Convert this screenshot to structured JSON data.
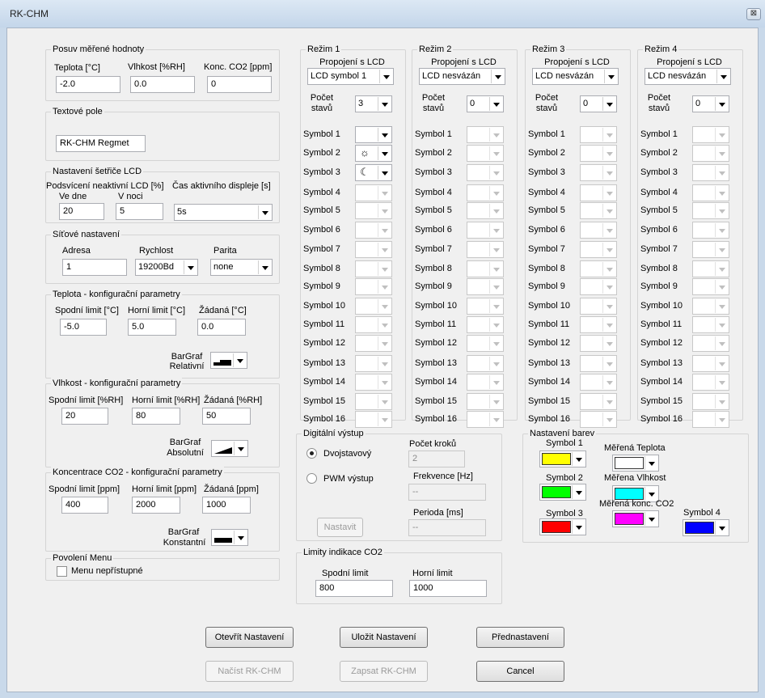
{
  "window": {
    "title": "RK-CHM",
    "close": "⊠"
  },
  "posuv": {
    "title": "Posuv měřené hodnoty",
    "labels": [
      "Teplota [°C]",
      "Vlhkost [%RH]",
      "Konc. CO2 [ppm]"
    ],
    "values": [
      "-2.0",
      "0.0",
      "0"
    ]
  },
  "textove": {
    "title": "Textové pole",
    "value": "RK-CHM Regmet"
  },
  "setric": {
    "title": "Nastavení šetřiče LCD",
    "label1": "Podsvícení neaktivní LCD [%]",
    "label2": "Čas aktivního displeje [s]",
    "ve_dne": "Ve dne",
    "v_noci": "V noci",
    "dne_value": "20",
    "noci_value": "5",
    "cas_value": "5s"
  },
  "sitove": {
    "title": "Síťové nastavení",
    "adresa_label": "Adresa",
    "rychlost_label": "Rychlost",
    "parita_label": "Parita",
    "adresa": "1",
    "rychlost": "19200Bd",
    "parita": "none"
  },
  "teplota": {
    "title": "Teplota - konfigurační parametry",
    "labels": [
      "Spodní limit [°C]",
      "Horní limit [°C]",
      "Žádaná [°C]"
    ],
    "values": [
      "-5.0",
      "5.0",
      "0.0"
    ],
    "bargraf": "BarGraf",
    "mode": "Relativní"
  },
  "vlhkost": {
    "title": "Vlhkost - konfigurační parametry",
    "labels": [
      "Spodní limit [%RH]",
      "Horní limit [%RH]",
      "Žádaná [%RH]"
    ],
    "values": [
      "20",
      "80",
      "50"
    ],
    "bargraf": "BarGraf",
    "mode": "Absolutní"
  },
  "co2": {
    "title": "Koncentrace CO2 - konfigurační parametry",
    "labels": [
      "Spodní limit [ppm]",
      "Horní limit [ppm]",
      "Žádaná [ppm]"
    ],
    "values": [
      "400",
      "2000",
      "1000"
    ],
    "bargraf": "BarGraf",
    "mode": "Konstantní"
  },
  "menu": {
    "title": "Povolení Menu",
    "checkbox_label": "Menu nepřístupné"
  },
  "rezimy": [
    {
      "title": "Režim 1",
      "lcd_label": "Propojení s LCD",
      "lcd_value": "LCD symbol 1",
      "pocet_label": "Počet stavů",
      "pocet_value": "3"
    },
    {
      "title": "Režim 2",
      "lcd_label": "Propojení s LCD",
      "lcd_value": "LCD nesvázán",
      "pocet_label": "Počet stavů",
      "pocet_value": "0"
    },
    {
      "title": "Režim 3",
      "lcd_label": "Propojení s LCD",
      "lcd_value": "LCD nesvázán",
      "pocet_label": "Počet stavů",
      "pocet_value": "0"
    },
    {
      "title": "Režim 4",
      "lcd_label": "Propojení s LCD",
      "lcd_value": "LCD nesvázán",
      "pocet_label": "Počet stavů",
      "pocet_value": "0"
    }
  ],
  "symbol_labels": [
    "Symbol 1",
    "Symbol 2",
    "Symbol 3",
    "Symbol 4",
    "Symbol 5",
    "Symbol 6",
    "Symbol 7",
    "Symbol 8",
    "Symbol 9",
    "Symbol 10",
    "Symbol 11",
    "Symbol 12",
    "Symbol 13",
    "Symbol 14",
    "Symbol 15",
    "Symbol 16"
  ],
  "rezim1_glyphs": {
    "symbol2": "☼",
    "symbol3": "☾",
    "symbol2_icon": "sun-icon",
    "symbol3_icon": "moon-icon"
  },
  "digital": {
    "title": "Digitální výstup",
    "radio1": "Dvojstavový",
    "radio2": "PWM výstup",
    "pocet_kroku_label": "Počet kroků",
    "pocet_kroku": "2",
    "frekvence_label": "Frekvence [Hz]",
    "frekvence": "--",
    "perioda_label": "Perioda [ms]",
    "perioda": "--",
    "nastavit": "Nastavit"
  },
  "barvy": {
    "title": "Nastavení barev",
    "items": [
      {
        "label": "Symbol 1",
        "color": "#ffff00"
      },
      {
        "label": "Symbol 2",
        "color": "#00ff00"
      },
      {
        "label": "Symbol 3",
        "color": "#ff0000"
      },
      {
        "label": "Měřená Teplota",
        "color": "#ffffff"
      },
      {
        "label": "Měřena Vlhkost",
        "color": "#00ffff"
      },
      {
        "label": "Měřená konc. CO2",
        "color": "#ff00ff"
      },
      {
        "label": "Symbol 4",
        "color": "#0000ff"
      }
    ]
  },
  "limity": {
    "title": "Limity indikace CO2",
    "spodni_label": "Spodní limit",
    "horni_label": "Horní limit",
    "spodni": "800",
    "horni": "1000"
  },
  "buttons": {
    "otevrit": "Otevřít Nastavení",
    "ulozit": "Uložit Nastavení",
    "prednastaveni": "Přednastavení",
    "nacist": "Načíst RK-CHM",
    "zapsat": "Zapsat RK-CHM",
    "cancel": "Cancel"
  }
}
